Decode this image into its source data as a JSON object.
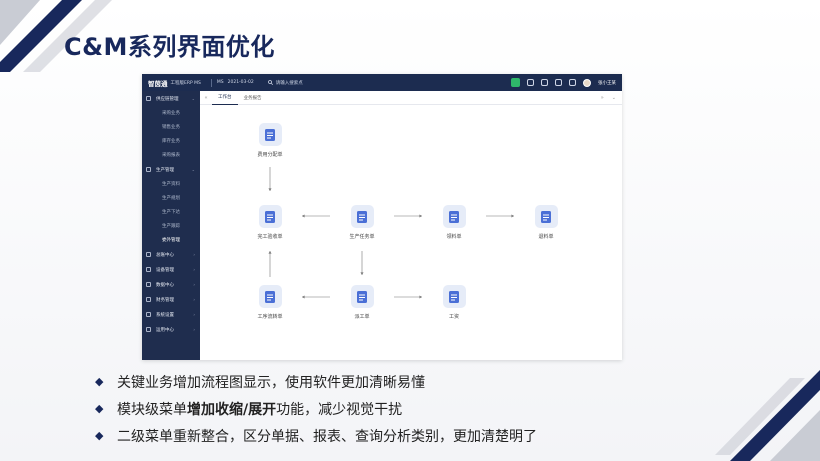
{
  "slide": {
    "title": "C&M系列界面优化",
    "colors": {
      "navy": "#18285c",
      "gray": "#c9ccd4"
    }
  },
  "app": {
    "topbar": {
      "logo": "智茵通",
      "product": "工程版ERP MS",
      "org": "MS",
      "date": "2021-03-02",
      "search_placeholder": "请输入搜索点",
      "user": "张小王某"
    },
    "sidebar": {
      "groups": [
        {
          "label": "供应链管理",
          "expanded": true,
          "items": [
            "采购业务",
            "销售业务",
            "库存业务",
            "采购报表"
          ]
        },
        {
          "label": "生产管理",
          "expanded": true,
          "items": [
            "生产资料",
            "生产规划",
            "生产下达",
            "生产跟踪",
            "委外管理"
          ]
        },
        {
          "label": "总账中心"
        },
        {
          "label": "设备管理"
        },
        {
          "label": "数据中心"
        },
        {
          "label": "财务管理"
        },
        {
          "label": "系统设置"
        },
        {
          "label": "运用中心"
        }
      ]
    },
    "tabs": {
      "items": [
        "工作台",
        "业务报告"
      ],
      "active": 0
    },
    "flow": {
      "nodes": [
        {
          "label": "费用分配单",
          "icon": "document-person-icon"
        },
        {
          "label": "完工验收单",
          "icon": "document-check-icon"
        },
        {
          "label": "生产任务单",
          "icon": "document-list-icon"
        },
        {
          "label": "领料单",
          "icon": "document-user-icon"
        },
        {
          "label": "退料单",
          "icon": "document-return-icon"
        },
        {
          "label": "工序流转单",
          "icon": "document-flow-icon"
        },
        {
          "label": "派工单",
          "icon": "document-dispatch-icon"
        },
        {
          "label": "工资",
          "icon": "document-salary-icon"
        }
      ]
    }
  },
  "bullets": [
    {
      "parts": [
        {
          "text": "关键业务增加流程图显示，使用软件更加清晰易懂",
          "bold": false
        }
      ]
    },
    {
      "parts": [
        {
          "text": "模块级菜单",
          "bold": false
        },
        {
          "text": "增加收缩/展开",
          "bold": true
        },
        {
          "text": "功能，减少视觉干扰",
          "bold": false
        }
      ]
    },
    {
      "parts": [
        {
          "text": "二级菜单重新整合，区分单据、报表、查询分析类别，更加清楚明了",
          "bold": false
        }
      ]
    }
  ]
}
